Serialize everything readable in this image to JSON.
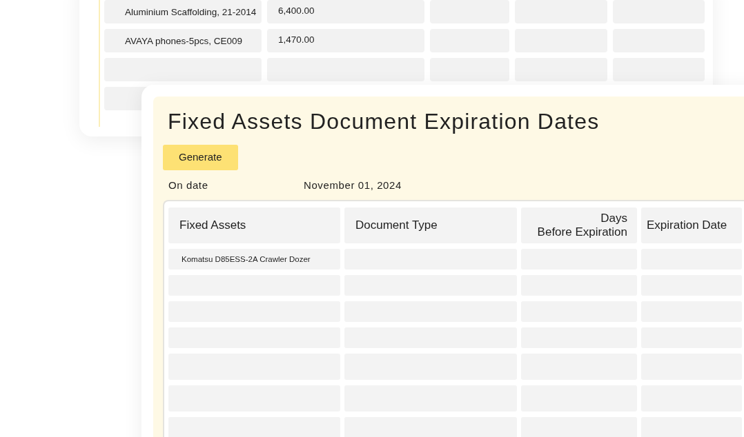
{
  "back_table": {
    "rows": [
      {
        "cells": [
          "Aluminium Scaffolding, 21-2014",
          "6,400.00"
        ]
      },
      {
        "cells": [
          "AVAYA phones-5pcs, CE009",
          "1,470.00"
        ]
      }
    ]
  },
  "report": {
    "title": "Fixed Assets Document Expiration Dates",
    "generate_button": "Generate",
    "on_date_label": "On date",
    "on_date_value": "November 01, 2024",
    "columns": [
      "Fixed Assets",
      "Document Type",
      "Days\nBefore Expiration",
      "Expiration Date"
    ],
    "rows": [
      {
        "cells": [
          "Komatsu D85ESS-2A Crawler Dozer",
          "",
          "",
          ""
        ]
      }
    ]
  }
}
